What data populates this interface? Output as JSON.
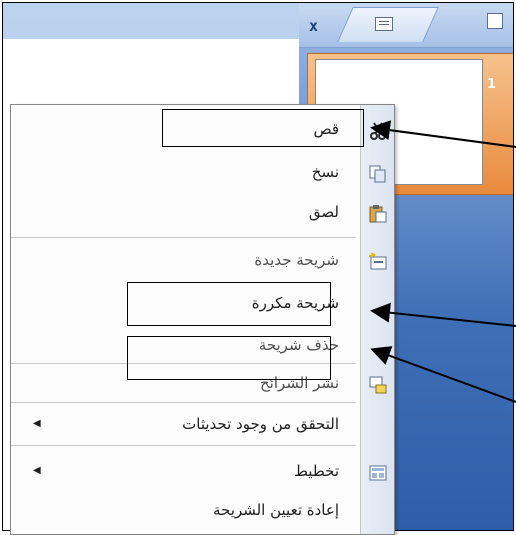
{
  "tabs": {
    "close_label": "x"
  },
  "thumbnail": {
    "number": "1"
  },
  "menu": {
    "items": [
      {
        "label": "قص",
        "icon": "scissors-icon"
      },
      {
        "label": "نسخ",
        "icon": "copy-icon"
      },
      {
        "label": "لصق",
        "icon": "paste-icon"
      },
      {
        "label": "شريحة جديدة",
        "icon": "new-slide-icon"
      },
      {
        "label": "شريحة مكررة",
        "icon": ""
      },
      {
        "label": "حذف شريحة",
        "icon": ""
      },
      {
        "label": "نشر الشرائح",
        "icon": "publish-slides-icon"
      },
      {
        "label": "التحقق من وجود تحديثات",
        "icon": "",
        "submenu": true
      },
      {
        "label": "تخطيط",
        "icon": "layout-icon",
        "submenu": true
      },
      {
        "label": "إعادة تعيين الشريحة",
        "icon": ""
      }
    ]
  },
  "colors": {
    "accent": "#e98a3c",
    "pane": "#3f6fb7"
  }
}
